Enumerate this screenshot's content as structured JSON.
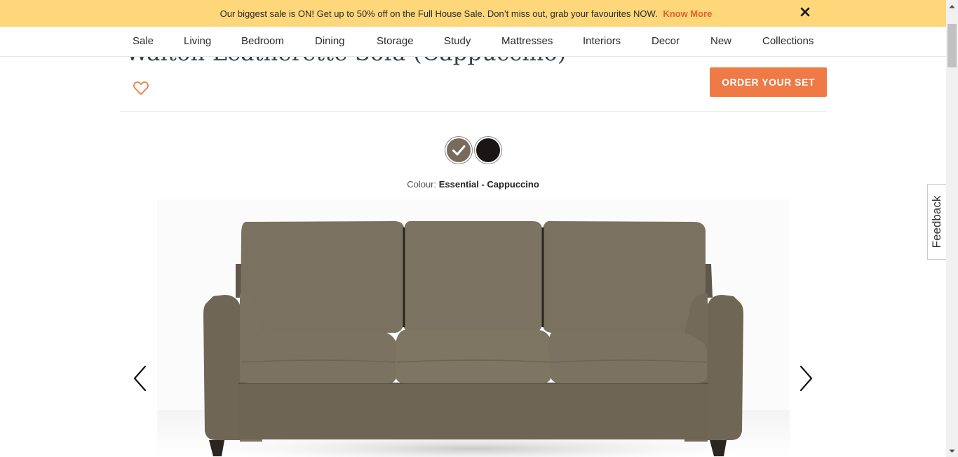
{
  "promo": {
    "message": "Our biggest sale is ON! Get up to 50% off on the Full House Sale. Don’t miss out, grab your favourites NOW.",
    "link_label": "Know More",
    "close_label": "✕"
  },
  "nav": {
    "items": [
      {
        "label": "Sale"
      },
      {
        "label": "Living"
      },
      {
        "label": "Bedroom"
      },
      {
        "label": "Dining"
      },
      {
        "label": "Storage"
      },
      {
        "label": "Study"
      },
      {
        "label": "Mattresses"
      },
      {
        "label": "Interiors"
      },
      {
        "label": "Decor"
      },
      {
        "label": "New"
      },
      {
        "label": "Collections"
      }
    ]
  },
  "product": {
    "title": "Walton Leatherette Sofa (Cappuccino)",
    "order_button": "ORDER YOUR SET",
    "colour_prefix": "Colour:",
    "colour_value": "Essential - Cappuccino",
    "swatches": [
      {
        "name": "Cappuccino",
        "color": "#776b5d",
        "selected": true
      },
      {
        "name": "Black",
        "color": "#1b1615",
        "selected": false
      }
    ]
  },
  "feedback": {
    "label": "Feedback"
  },
  "colors": {
    "promo_bg": "#fdd77a",
    "accent": "#ef7a46",
    "sofa": "#786f5e"
  }
}
